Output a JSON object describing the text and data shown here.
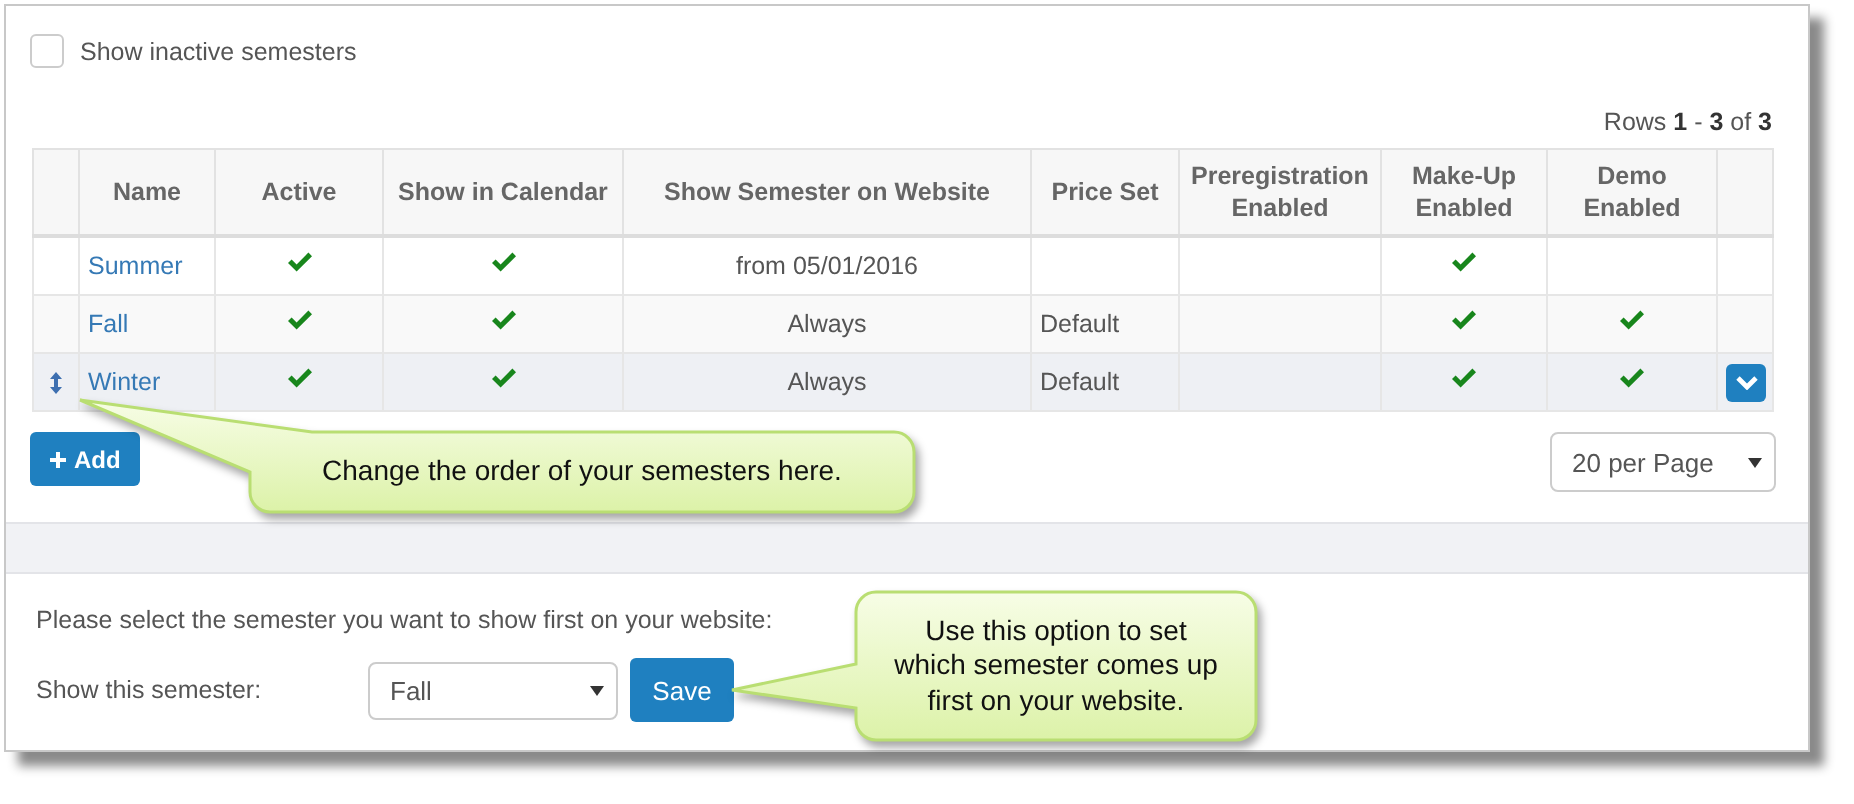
{
  "show_inactive": {
    "label": "Show inactive semesters",
    "checked": false
  },
  "rows_info": "Rows **1** - **3** of **3**",
  "table": {
    "columns": [
      "Name",
      "Active",
      "Show in Calendar",
      "Show Semester on Website",
      "Price Set",
      "Preregistration Enabled",
      "Make-Up Enabled",
      "Demo Enabled"
    ],
    "rows": [
      {
        "name": "Summer",
        "active": true,
        "show_in_calendar": true,
        "website": "from 05/01/2016",
        "preregistration": false,
        "make_up": true,
        "demo": false,
        "selected": false
      },
      {
        "name": "Fall",
        "active": true,
        "show_in_calendar": true,
        "website": "Always",
        "price_set": "Default",
        "preregistration": false,
        "make_up": true,
        "demo": true,
        "selected": false
      },
      {
        "name": "Winter",
        "active": true,
        "show_in_calendar": true,
        "website": "Always",
        "price_set": "Default",
        "preregistration": false,
        "make_up": true,
        "demo": true,
        "selected": true
      }
    ]
  },
  "add_button": "Add",
  "per_page": "20 per Page",
  "first_semester": {
    "prompt": "Please select the semester you want to show first on your website:",
    "label": "Show this semester:",
    "value": "Fall",
    "save_button": "Save"
  },
  "callouts": [
    {
      "text": "Change the order of your semesters here."
    },
    {
      "text": "Use this option to set which semester comes up first on your website."
    }
  ]
}
